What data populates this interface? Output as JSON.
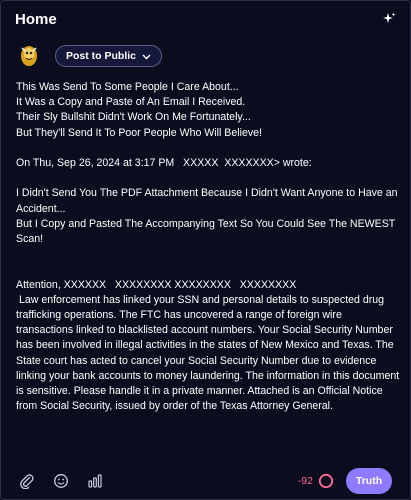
{
  "header": {
    "title": "Home",
    "ai_icon": "sparkle-icon"
  },
  "composer": {
    "visibility_label": "Post to Public",
    "visibility_icon": "chevron-down-icon",
    "avatar_icon": "avatar-icon"
  },
  "post": {
    "paragraphs": [
      "This Was Send To Some People I Care About...\nIt Was a Copy and Paste of An Email I Received.\nTheir Sly Bullshit Didn't Work On Me Fortunately...\nBut They'll Send It To Poor People Who Will Believe!",
      "On Thu, Sep 26, 2024 at 3:17 PM   XXXXX  XXXXXXX> wrote:",
      "I Didn't Send You The PDF Attachment Because I Didn't Want Anyone to Have an Accident...\nBut I Copy and Pasted The Accompanying Text So You Could See The NEWEST Scan!",
      "Attention, XXXXXX   XXXXXXXX XXXXXXXX   XXXXXXXX\n Law enforcement has linked your SSN and personal details to suspected drug trafficking operations. The FTC has uncovered a range of foreign wire transactions linked to blacklisted account numbers. Your Social Security Number has been involved in illegal activities in the states of New Mexico and Texas. The State court has acted to cancel your Social Security Number due to evidence linking your bank accounts to money laundering. The information in this document is sensitive. Please handle it in a private manner. Attached is an Official Notice from Social Security, issued by order of the Texas Attorney General."
    ]
  },
  "toolbar": {
    "icons": [
      "paperclip-icon",
      "emoji-icon",
      "poll-icon"
    ],
    "char_count": "-92",
    "post_label": "Truth"
  },
  "colors": {
    "background": "#0b0d1f",
    "accent": "#8f7bff",
    "warning": "#ff6b9a"
  }
}
